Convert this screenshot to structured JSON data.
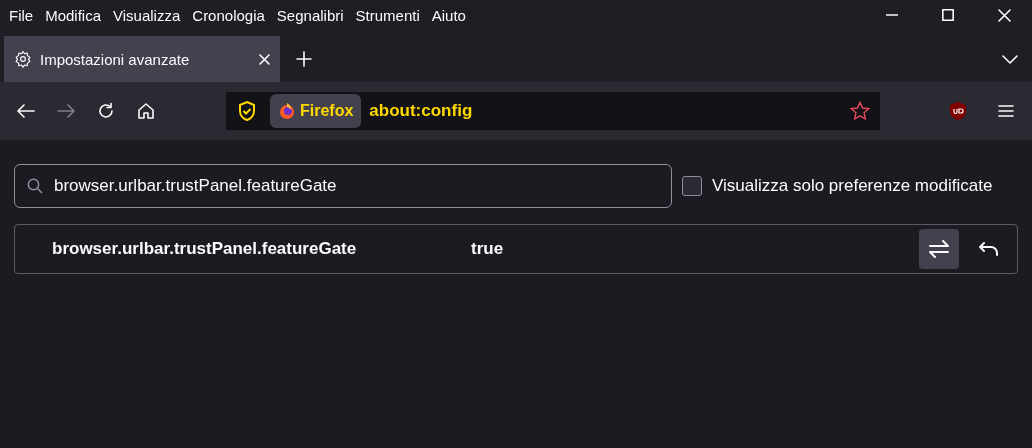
{
  "menu_bar": {
    "items": [
      "File",
      "Modifica",
      "Visualizza",
      "Cronologia",
      "Segnalibri",
      "Strumenti",
      "Aiuto"
    ]
  },
  "tabs": [
    {
      "label": "Impostazioni avanzate",
      "selected": true
    }
  ],
  "nav_bar": {
    "back_disabled": false,
    "forward_disabled": true,
    "identity_label": "Firefox",
    "url": "about:config",
    "bookmarked": false
  },
  "search": {
    "value": "browser.urlbar.trustPanel.featureGate"
  },
  "modified_only": {
    "label": "Visualizza solo preferenze modificate",
    "checked": false
  },
  "preferences": [
    {
      "name": "browser.urlbar.trustPanel.featureGate",
      "value": "true",
      "kind": "boolean"
    }
  ]
}
